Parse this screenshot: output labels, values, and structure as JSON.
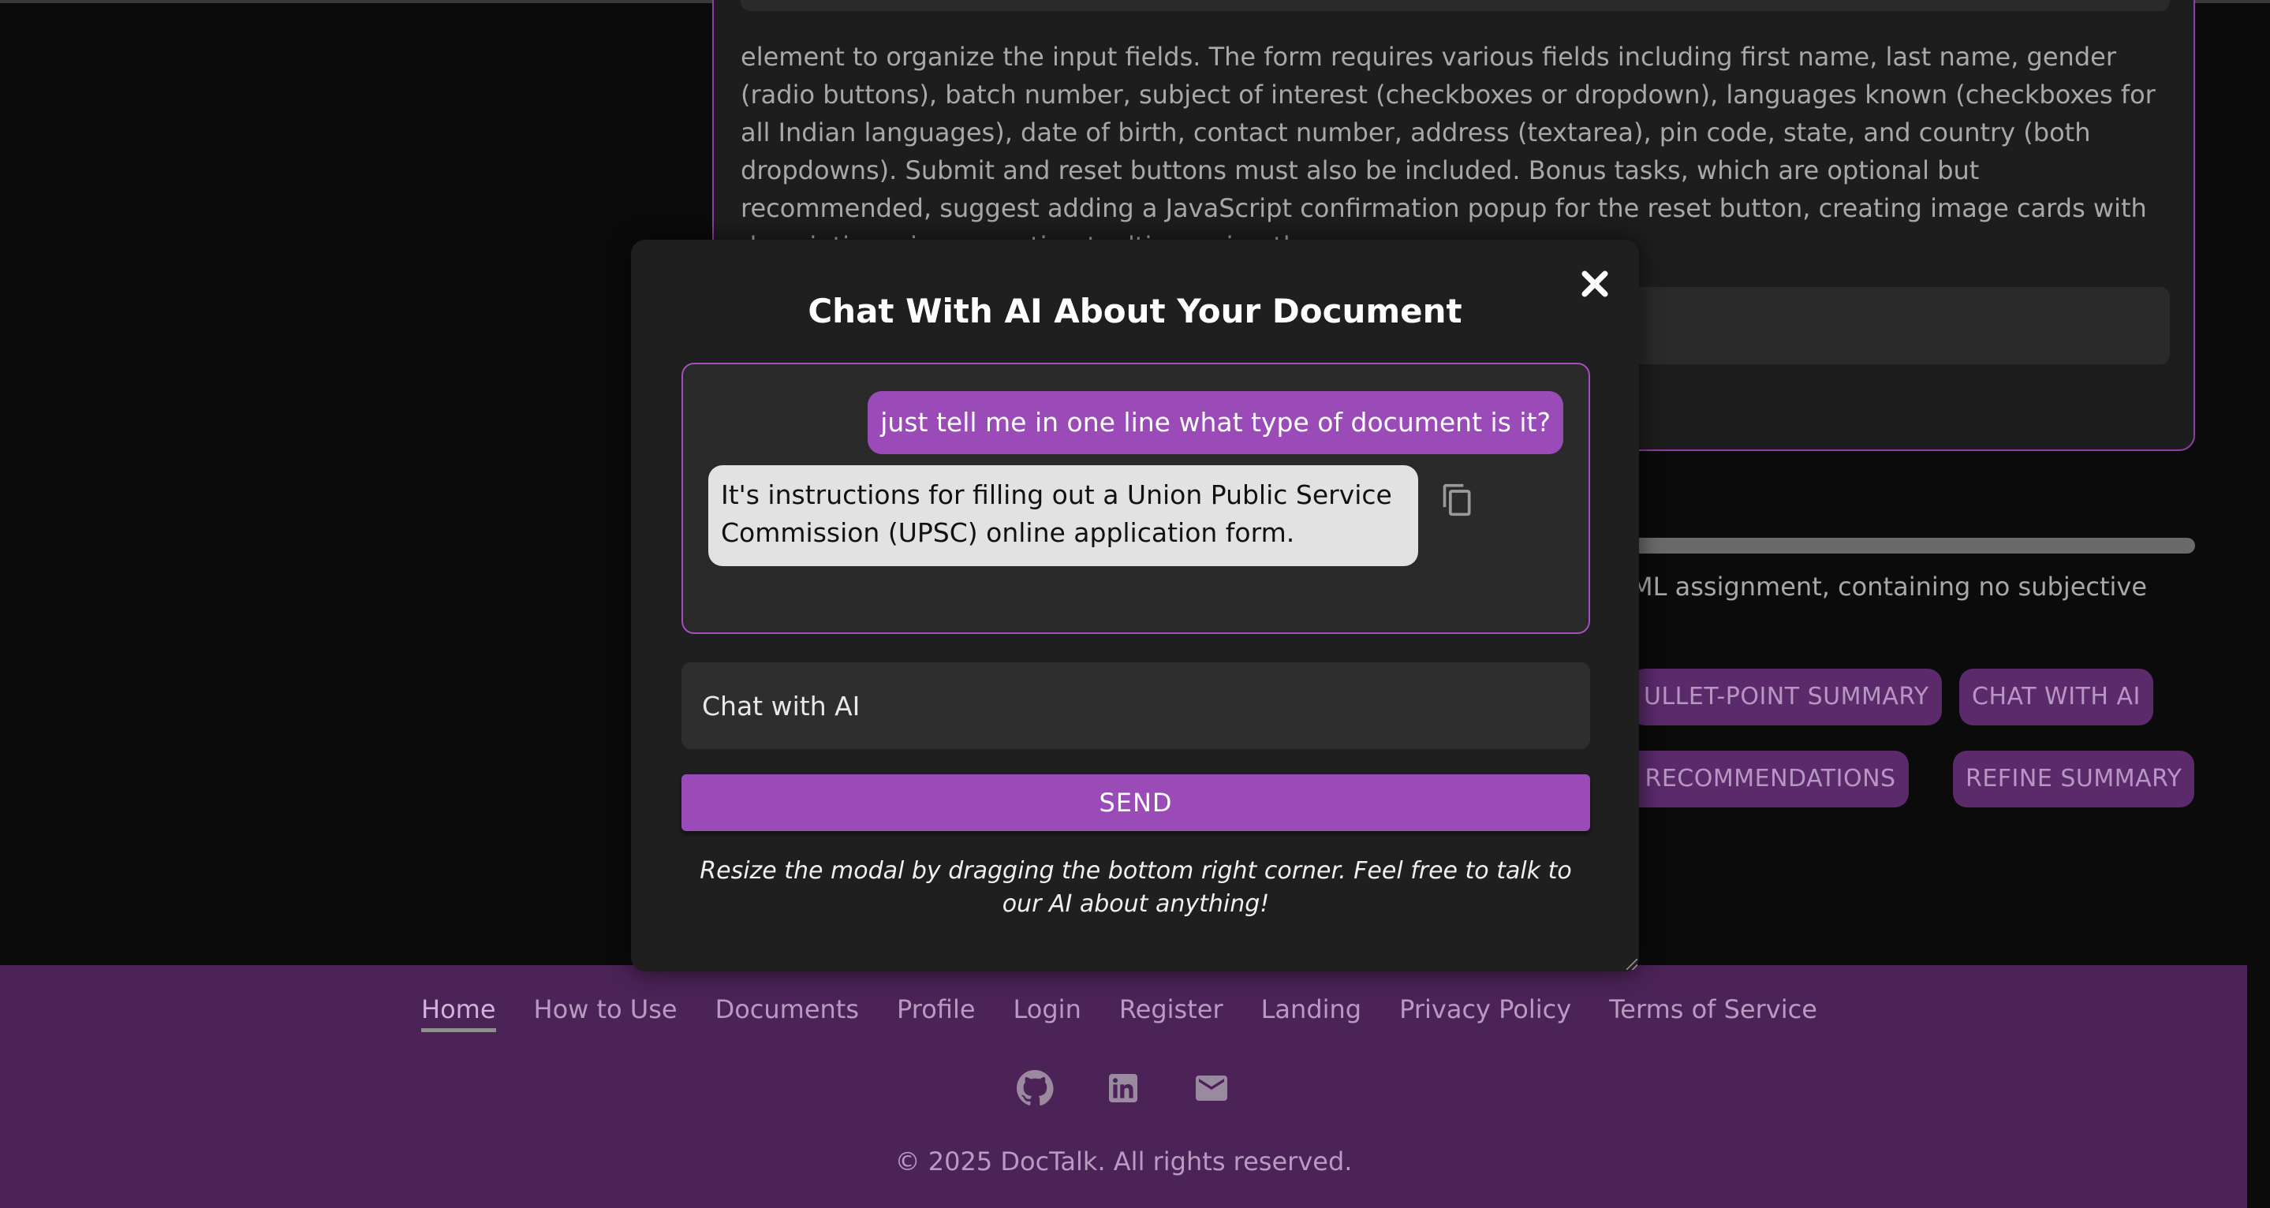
{
  "background": {
    "text": "element to organize the input fields. The form requires various fields including first name, last name, gender (radio buttons), batch number, subject of interest (checkboxes or dropdown), languages known (checkboxes for all Indian languages), date of birth, contact number, address (textarea), pin code, state, and country (both dropdowns). Submit and reset buttons must also be included. Bonus tasks, which are optional but recommended, suggest adding a JavaScript confirmation popup for the reset button, creating image cards with descriptions, incorporating tooltips, using the",
    "progress_fraction": 1.0,
    "summary_text": "ML assignment, containing no subjective",
    "buttons": {
      "bullet_summary": "ULLET-POINT SUMMARY",
      "chat_with_ai": "CHAT WITH AI",
      "recommendations": "E RECOMMENDATIONS",
      "refine_summary": "REFINE SUMMARY"
    }
  },
  "modal": {
    "title": "Chat With AI About Your Document",
    "messages": {
      "user": "just tell me in one line what type of document is it?",
      "ai": "It's instructions for filling out a Union Public Service Commission (UPSC) online application form."
    },
    "input_placeholder": "Chat with AI",
    "send_label": "SEND",
    "hint": "Resize the modal by dragging the bottom right corner. Feel free to talk to our AI about anything!"
  },
  "footer": {
    "nav": [
      "Home",
      "How to Use",
      "Documents",
      "Profile",
      "Login",
      "Register",
      "Landing",
      "Privacy Policy",
      "Terms of Service"
    ],
    "icons": [
      "github-icon",
      "linkedin-icon",
      "email-icon"
    ],
    "copyright": "© 2025 DocTalk. All rights reserved."
  },
  "colors": {
    "accent": "#9b4bb8",
    "footer_bg": "#4b2356",
    "modal_bg": "#1f1f1f",
    "page_bg": "#0b0b0b"
  }
}
